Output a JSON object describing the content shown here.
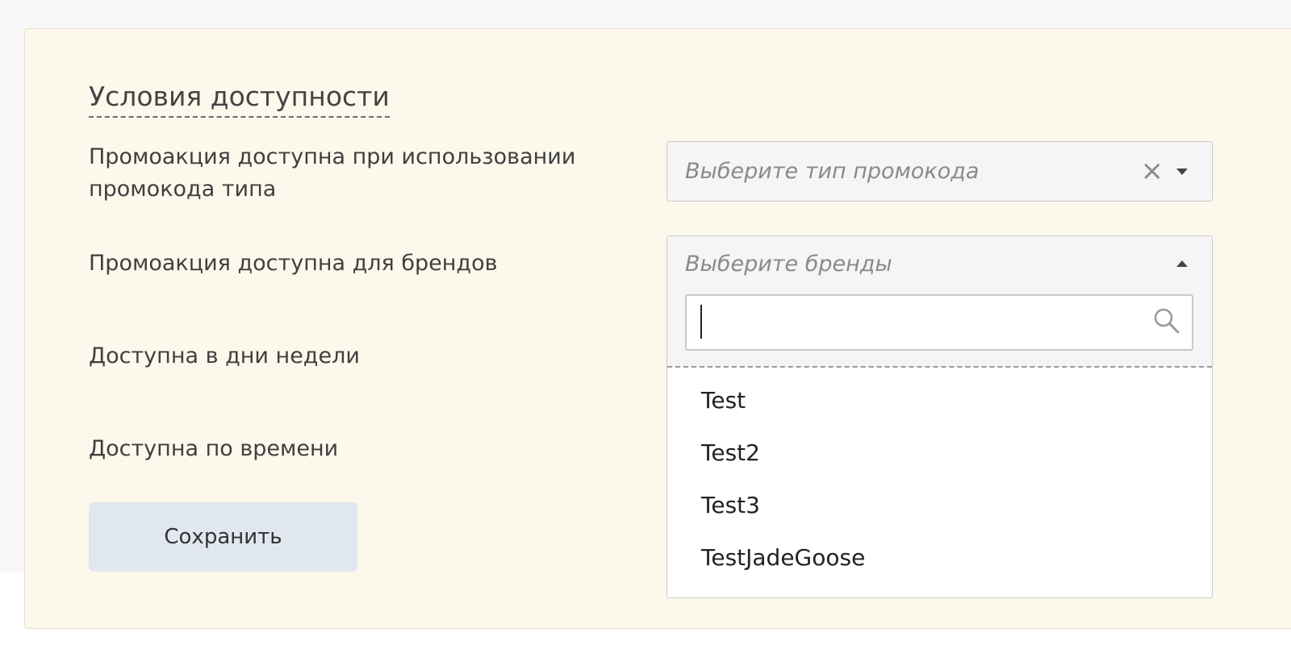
{
  "section": {
    "title": "Условия доступности"
  },
  "rows": {
    "promo_type": {
      "label": "Промоакция доступна при использовании промокода типа",
      "placeholder": "Выберите тип промокода",
      "clear_icon": "close-icon",
      "toggle_icon": "caret-down-icon"
    },
    "brands": {
      "label": "Промоакция доступна для брендов",
      "placeholder": "Выберите бренды",
      "toggle_icon": "caret-up-icon",
      "search_value": "",
      "search_icon": "search-icon",
      "options": [
        "Test",
        "Test2",
        "Test3",
        "TestJadeGoose"
      ]
    },
    "weekdays": {
      "label": "Доступна в дни недели"
    },
    "time": {
      "label": "Доступна по времени"
    }
  },
  "actions": {
    "save_label": "Сохранить"
  },
  "colors": {
    "panel_bg": "#fdf8ec",
    "button_bg": "#e0e7ef",
    "page_bg": "#f7f7f7"
  }
}
